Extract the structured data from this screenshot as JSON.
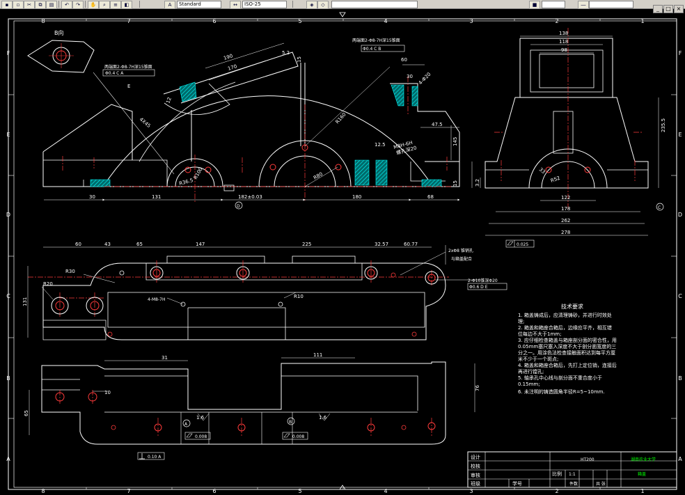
{
  "toolbar": {
    "buttons": [
      "save-icon",
      "print-icon",
      "cut-icon",
      "copy-icon",
      "paste-icon",
      "undo-icon",
      "redo-icon",
      "pan-icon",
      "zoom-icon",
      "properties-icon",
      "layer-icon",
      "text-style-icon",
      "dimstyle-icon"
    ],
    "text_style_combo": "Standard",
    "dim_style_combo": "ISO-25"
  },
  "grid": {
    "top_cols": [
      "8",
      "7",
      "6",
      "5",
      "4",
      "3",
      "2",
      "1"
    ],
    "bottom_cols": [
      "8",
      "7",
      "6",
      "5",
      "4",
      "3",
      "2",
      "1"
    ],
    "left_rows": [
      "F",
      "E",
      "D",
      "C",
      "B",
      "A"
    ],
    "right_rows": [
      "F",
      "E",
      "D",
      "C",
      "B",
      "A"
    ]
  },
  "views": {
    "front": {
      "label_b": "B向",
      "note_holes_left": "两端面2-Φ8-7H深15锥面",
      "fcf_left": "Φ0.4 C A",
      "note_holes_top": "两端面2-Φ8-7H深15锥面",
      "fcf_top": "Φ0.4 C B",
      "label_e": "E",
      "dim_190": "190",
      "dim_170": "170",
      "dim_5_2": "5.2",
      "dim_15": "15",
      "dim_12": "12",
      "dim_r160": "R160",
      "dim_r100": "R100",
      "dim_r80": "R80",
      "dim_r36": "R36.5",
      "dim_4x45": "4X45",
      "dim_60": "60",
      "dim_30": "30",
      "dim_4x20": "4-Φ20",
      "dim_47_5": "47.5",
      "dim_145": "145",
      "dim_12_5": "12.5",
      "dim_thread": "M8H-6H",
      "dim_thread2": "螺孔深20",
      "dim_30b": "30",
      "dim_131": "131",
      "dim_182": "182±0.03",
      "dim_180": "180",
      "dim_68": "68",
      "dim_15b": "15",
      "label_d": "D"
    },
    "side": {
      "dim_138": "138",
      "dim_118": "118",
      "dim_98": "98",
      "dim_235": "235.5",
      "dim_r52": "R52",
      "dim_33": "33",
      "dim_122": "122",
      "dim_178": "178",
      "dim_262": "262",
      "dim_278": "278",
      "dim_3_2": "3.2",
      "label_c": "C",
      "flatness": "0.025"
    },
    "top": {
      "dim_60": "60",
      "dim_43": "43",
      "dim_65": "65",
      "dim_147": "147",
      "dim_225": "225",
      "dim_32_57": "32.57",
      "dim_60_77": "60.77",
      "r30": "R30",
      "r20": "R20",
      "r10": "R10",
      "dim_131": "131",
      "note_pins": "2xΦ8 锥销孔",
      "note_pins2": "与箱盖配合",
      "note_holes": "2-Φ10锥深Φ20",
      "fcf": "Φ0.6 D E",
      "note_thread": "4-M8-7H"
    },
    "bottom": {
      "dim_31": "31",
      "dim_111": "111",
      "dim_76": "76",
      "dim_65": "65",
      "dim_10": "10",
      "rough1": "1.6",
      "rough2": "1.6",
      "label_a": "A",
      "label_b": "B",
      "flat1": "0.008",
      "flat2": "0.008",
      "perp": "0.10 A"
    }
  },
  "tech": {
    "title": "技术要求",
    "lines": [
      "1. 箱盖铸成后，应清理铸砂，并进行时效处",
      "理;",
      "2. 箱盖和箱座合箱后，边缘应平齐，相互错",
      "位每边不大于1mm;",
      "3. 应仔细检查箱盖与箱座剖分面的密合性，用",
      "0.05mm塞尺塞入深度不大于剖分面宽度的三",
      "分之一。用涂色法检查接触面积达到每平方厘",
      "米不少于一个斑点;",
      "4. 箱盖和箱座合箱后，先打上定位销，连接后",
      "再进行镗孔;",
      "5. 轴承孔中心线与剖分面不重合度小于",
      "0.15mm;",
      "6. 未注明的铸造圆角半径R=5~10mm."
    ]
  },
  "title_block": {
    "design": "设计",
    "check": "校核",
    "review": "审核",
    "class": "班级",
    "student_no": "学号",
    "scale_label": "比例",
    "scale_value": "1:1",
    "material": "HT200",
    "school": "湖南农业大学",
    "part_name": "箱盖",
    "count": "件数",
    "weight": "重量",
    "sheet": "共  张"
  }
}
